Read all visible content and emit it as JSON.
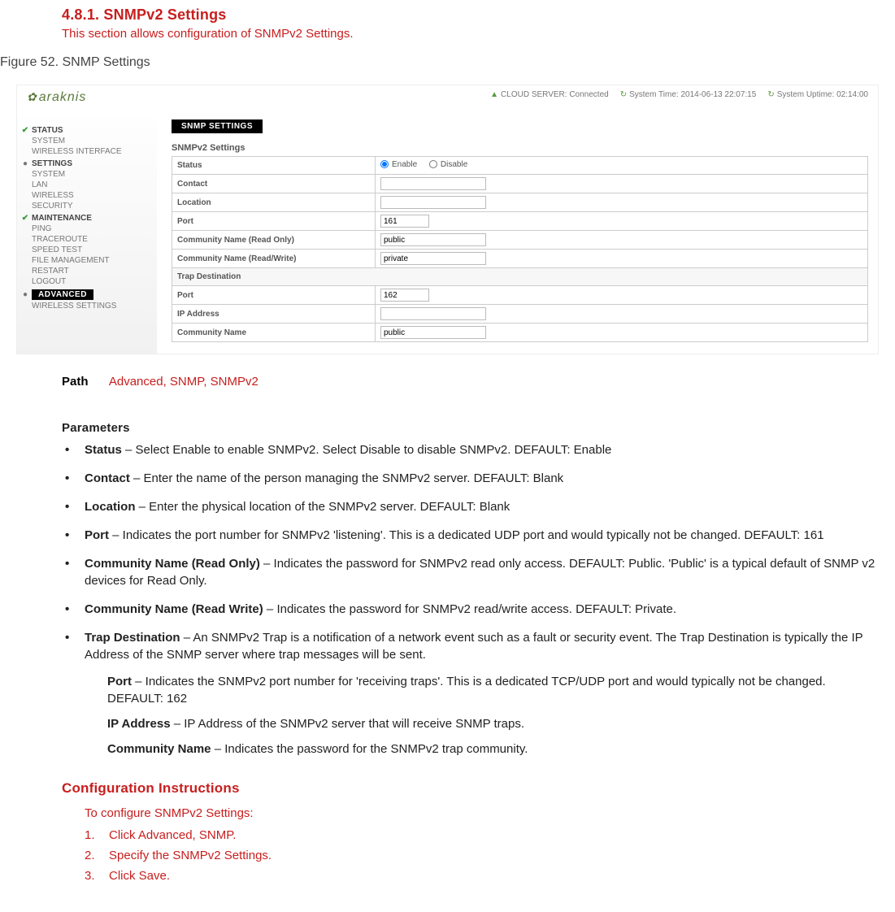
{
  "heading": "4.8.1. SNMPv2 Settings",
  "subheading": "This section allows configuration of SNMPv2 Settings.",
  "figure_caption": "Figure 52. SNMP Settings",
  "screenshot": {
    "logo": "araknis",
    "status_bar": {
      "cloud_label": "CLOUD SERVER:",
      "cloud_value": "Connected",
      "systime_label": "System Time:",
      "systime_value": "2014-06-13 22:07:15",
      "uptime_label": "System Uptime:",
      "uptime_value": "02:14:00"
    },
    "sidebar": {
      "status": {
        "label": "STATUS",
        "items": [
          "SYSTEM",
          "WIRELESS INTERFACE"
        ]
      },
      "settings": {
        "label": "SETTINGS",
        "items": [
          "SYSTEM",
          "LAN",
          "WIRELESS",
          "SECURITY"
        ]
      },
      "maintenance": {
        "label": "MAINTENANCE",
        "items": [
          "PING",
          "TRACEROUTE",
          "SPEED TEST",
          "FILE MANAGEMENT",
          "RESTART",
          "LOGOUT"
        ]
      },
      "advanced": {
        "label": "ADVANCED",
        "items": [
          "WIRELESS SETTINGS"
        ]
      }
    },
    "tab": "SNMP SETTINGS",
    "panel_title": "SNMPv2 Settings",
    "rows": {
      "status": {
        "label": "Status",
        "enable": "Enable",
        "disable": "Disable"
      },
      "contact": {
        "label": "Contact",
        "value": ""
      },
      "location": {
        "label": "Location",
        "value": ""
      },
      "port": {
        "label": "Port",
        "value": "161"
      },
      "comm_ro": {
        "label": "Community Name (Read Only)",
        "value": "public"
      },
      "comm_rw": {
        "label": "Community Name (Read/Write)",
        "value": "private"
      },
      "trap_dest": {
        "label": "Trap Destination"
      },
      "trap_port": {
        "label": "Port",
        "value": "162"
      },
      "trap_ip": {
        "label": "IP Address",
        "value": ""
      },
      "trap_comm": {
        "label": "Community Name",
        "value": "public"
      }
    }
  },
  "path": {
    "label": "Path",
    "value": "Advanced, SNMP, SNMPv2"
  },
  "parameters_heading": "Parameters",
  "parameters": [
    {
      "term": "Status",
      "desc": " – Select Enable to enable SNMPv2. Select Disable to disable SNMPv2. DEFAULT: Enable"
    },
    {
      "term": "Contact",
      "desc": " – Enter the name of the person managing the SNMPv2 server. DEFAULT: Blank"
    },
    {
      "term": "Location",
      "desc": " – Enter the physical location of the SNMPv2 server. DEFAULT: Blank"
    },
    {
      "term": "Port",
      "desc": " – Indicates the port number for SNMPv2 'listening'. This is a dedicated UDP port and would typically not be changed. DEFAULT: 161"
    },
    {
      "term": "Community Name (Read Only)",
      "desc": " – Indicates the password for SNMPv2 read only access. DEFAULT: Public. 'Public' is a typical default of SNMP v2 devices for Read Only."
    },
    {
      "term": "Community Name (Read Write)",
      "desc": " – Indicates the password for SNMPv2 read/write access. DEFAULT: Private."
    },
    {
      "term": "Trap Destination",
      "desc": " – An SNMPv2 Trap is a notification of a network event such as a fault or security event. The Trap Destination is typically the IP Address of the SNMP server where trap messages will be sent."
    }
  ],
  "trap_sub": [
    {
      "term": "Port",
      "desc": " – Indicates the SNMPv2 port number for 'receiving traps'. This is a dedicated TCP/UDP port and would typically not be changed. DEFAULT: 162"
    },
    {
      "term": "IP Address",
      "desc": " – IP Address of the SNMPv2 server that will receive SNMP traps."
    },
    {
      "term": "Community Name",
      "desc": " – Indicates the password for the SNMPv2 trap community."
    }
  ],
  "config": {
    "heading": "Configuration Instructions",
    "intro": "To configure SNMPv2 Settings:",
    "steps": [
      "Click Advanced, SNMP.",
      "Specify the SNMPv2 Settings.",
      "Click Save."
    ]
  }
}
